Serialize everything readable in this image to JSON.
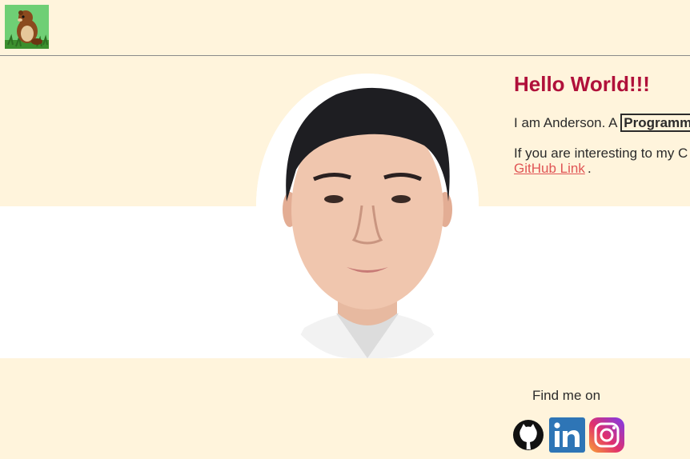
{
  "header": {
    "logo_icon": "beaver-logo-icon"
  },
  "intro": {
    "heading": "Hello World!!!",
    "line1_prefix": "I am Anderson. A ",
    "role": "Programm",
    "line2": "If you are interesting to my C",
    "github_link_label": "GitHub Link",
    "github_link_suffix": "."
  },
  "footer": {
    "find_label": "Find me on",
    "social_icons": [
      "github-icon",
      "linkedin-icon",
      "instagram-icon"
    ]
  },
  "colors": {
    "page_bg": "#fff4dc",
    "heading": "#b0103a",
    "link": "#e05555",
    "linkedin": "#2e75b6"
  }
}
